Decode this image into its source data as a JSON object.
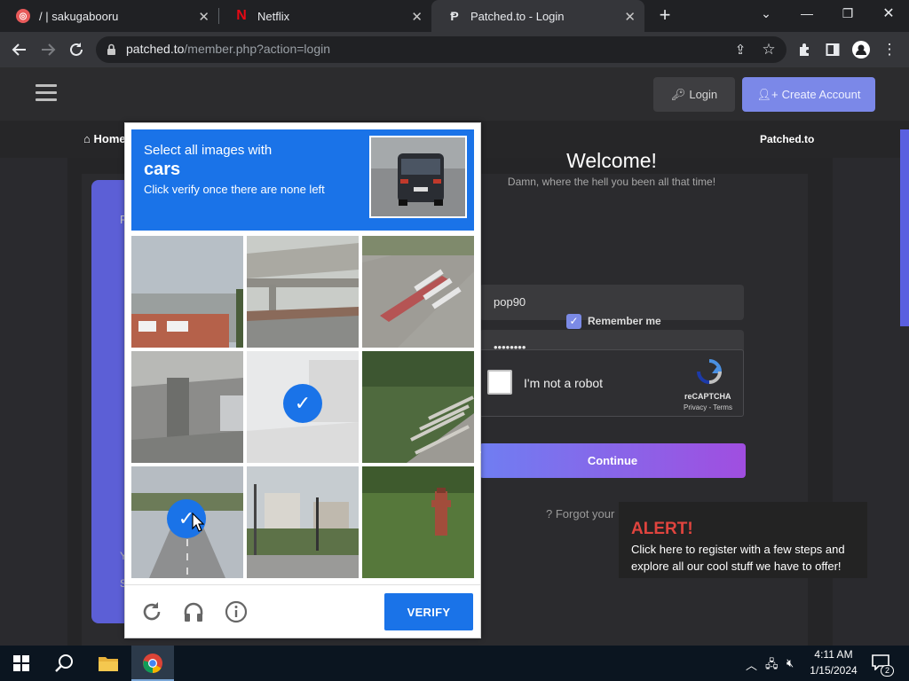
{
  "browser": {
    "tabs": [
      {
        "title": "/ | sakugabooru",
        "active": false
      },
      {
        "title": "Netflix",
        "active": false
      },
      {
        "title": "Patched.to - Login",
        "active": true
      }
    ],
    "url_host": "patched.to",
    "url_path": "/member.php?action=login"
  },
  "site": {
    "header": {
      "login_label": "Login",
      "create_account_label": "Create Account"
    },
    "nav": {
      "home_label": "Home",
      "site_label": "Patched.to"
    },
    "login_form": {
      "welcome_title": "Welcome!",
      "welcome_subtitle": "Damn, where the hell you been all that time!",
      "username_value": "pop90",
      "password_value": "••••••••",
      "remember_label": "Remember me",
      "remember_checked": true,
      "recaptcha_label": "I'm not a robot",
      "recaptcha_brand": "reCAPTCHA",
      "recaptcha_terms": "Privacy - Terms",
      "continue_label": "Continue",
      "forgot_label": "Forgot your"
    },
    "left_fragments": {
      "top": "F",
      "y": "Y",
      "s": "S"
    },
    "alert": {
      "title": "ALERT!",
      "text": "Click here to register with a few steps and explore all our cool stuff we have to offer!"
    }
  },
  "captcha": {
    "line1": "Select all images with",
    "target": "cars",
    "line3": "Click verify once there are none left",
    "tiles": [
      {
        "desc": "storefront",
        "selected": false
      },
      {
        "desc": "overpass",
        "selected": false
      },
      {
        "desc": "crosswalk",
        "selected": false
      },
      {
        "desc": "overpass-pillar",
        "selected": false
      },
      {
        "desc": "street-faded",
        "selected": true
      },
      {
        "desc": "stairs-grass",
        "selected": false
      },
      {
        "desc": "road",
        "selected": true
      },
      {
        "desc": "street-houses",
        "selected": false
      },
      {
        "desc": "fire-hydrant",
        "selected": false
      }
    ],
    "verify_label": "VERIFY"
  },
  "taskbar": {
    "time": "4:11 AM",
    "date": "1/15/2024",
    "notification_count": "2"
  }
}
